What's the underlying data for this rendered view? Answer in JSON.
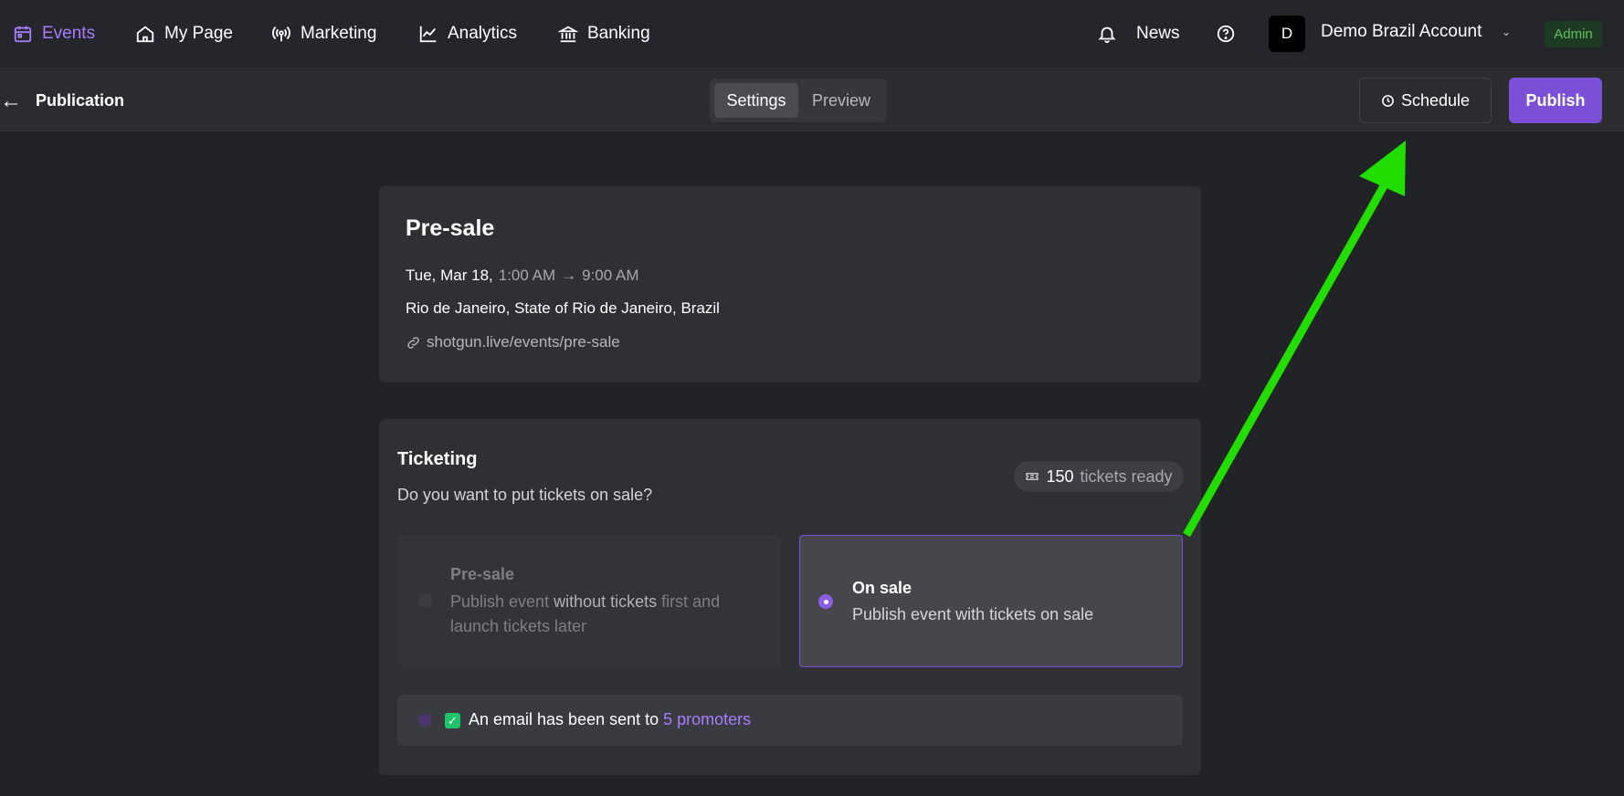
{
  "nav": {
    "items": [
      {
        "label": "Events",
        "icon": "calendar-icon"
      },
      {
        "label": "My Page",
        "icon": "home-icon"
      },
      {
        "label": "Marketing",
        "icon": "broadcast-icon"
      },
      {
        "label": "Analytics",
        "icon": "chart-line-icon"
      },
      {
        "label": "Banking",
        "icon": "bank-icon"
      }
    ],
    "news_label": "News",
    "account_initial": "D",
    "account_name": "Demo Brazil Account",
    "chevron": "⌄",
    "admin_badge": "Admin"
  },
  "subheader": {
    "back_arrow": "←",
    "title": "Publication",
    "tabs": {
      "settings": "Settings",
      "preview": "Preview"
    },
    "schedule_label": "Schedule",
    "publish_label": "Publish"
  },
  "event": {
    "name": "Pre-sale",
    "date_day": "Tue, Mar 18,",
    "time_start": "1:00 AM",
    "time_arrow": "→",
    "time_end": "9:00 AM",
    "location": "Rio de Janeiro, State of Rio de Janeiro, Brazil",
    "link": "shotgun.live/events/pre-sale"
  },
  "ticketing": {
    "title": "Ticketing",
    "question": "Do you want to put tickets on sale?",
    "ready_count": "150",
    "ready_suffix": "tickets ready",
    "options": [
      {
        "title": "Pre-sale",
        "desc_a": "Publish event ",
        "desc_bold": "without tickets",
        "desc_b": " first and launch tickets later",
        "selected": false
      },
      {
        "title": "On sale",
        "desc": "Publish event with tickets on sale",
        "selected": true
      }
    ],
    "email_prefix": "An email has been sent to ",
    "email_link": "5 promoters"
  },
  "colors": {
    "accent": "#7b4fd6",
    "active_nav": "#a77dfc",
    "annotation_arrow": "#22dd00",
    "check": "#1ec36a"
  }
}
